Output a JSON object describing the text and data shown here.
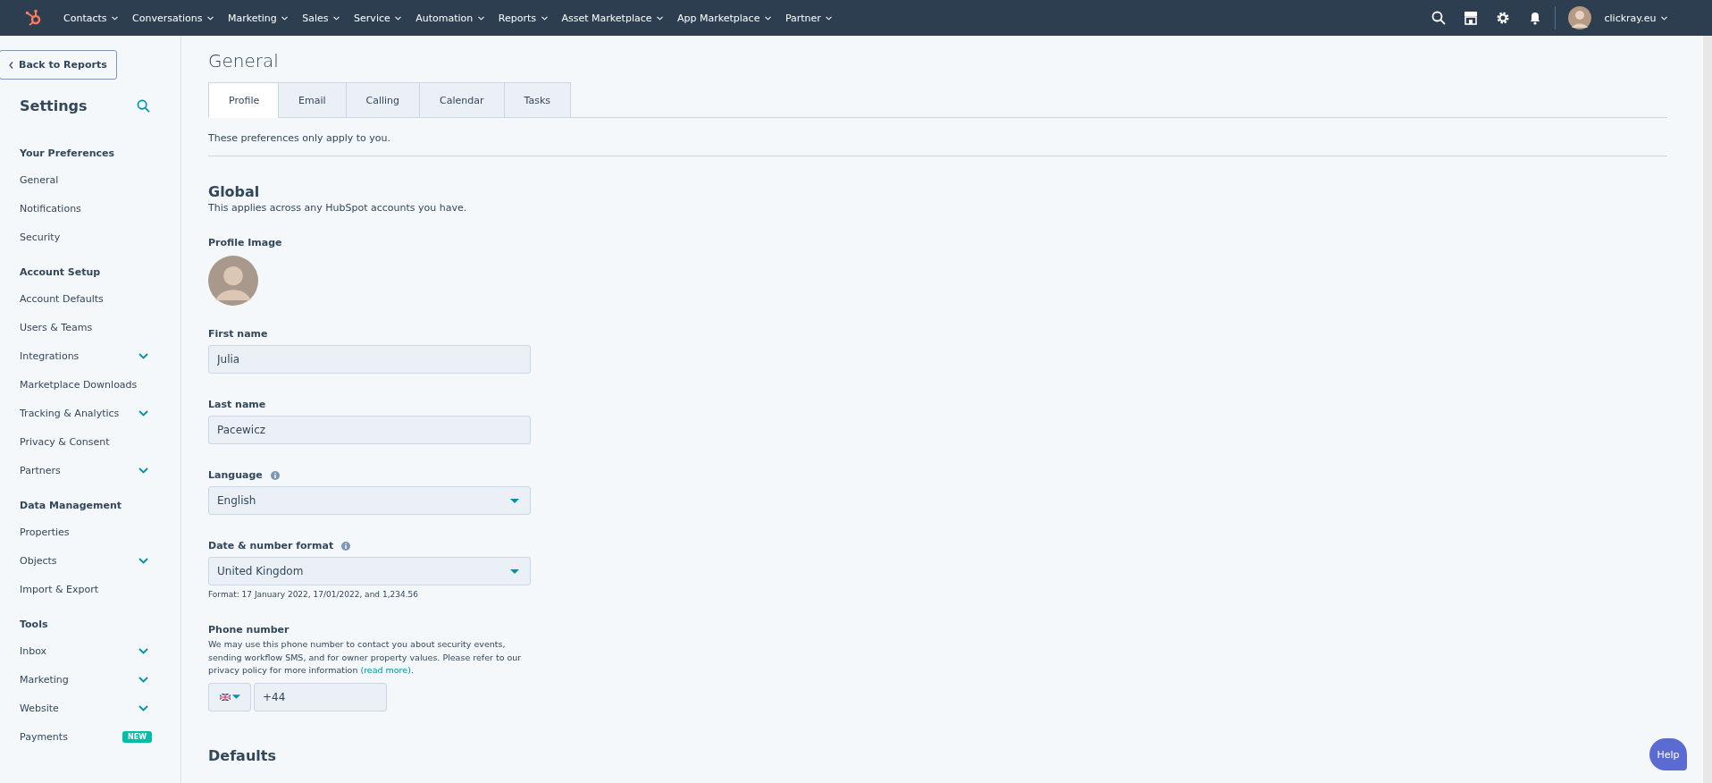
{
  "top_nav": {
    "menus": [
      "Contacts",
      "Conversations",
      "Marketing",
      "Sales",
      "Service",
      "Automation",
      "Reports",
      "Asset Marketplace",
      "App Marketplace",
      "Partner"
    ],
    "account": "clickray.eu"
  },
  "sidebar": {
    "back_button": "Back to Reports",
    "title": "Settings",
    "sections": [
      {
        "heading": "Your Preferences",
        "items": [
          {
            "label": "General",
            "expandable": false
          },
          {
            "label": "Notifications",
            "expandable": false
          },
          {
            "label": "Security",
            "expandable": false
          }
        ]
      },
      {
        "heading": "Account Setup",
        "items": [
          {
            "label": "Account Defaults",
            "expandable": false
          },
          {
            "label": "Users & Teams",
            "expandable": false
          },
          {
            "label": "Integrations",
            "expandable": true
          },
          {
            "label": "Marketplace Downloads",
            "expandable": false
          },
          {
            "label": "Tracking & Analytics",
            "expandable": true
          },
          {
            "label": "Privacy & Consent",
            "expandable": false
          },
          {
            "label": "Partners",
            "expandable": true
          }
        ]
      },
      {
        "heading": "Data Management",
        "items": [
          {
            "label": "Properties",
            "expandable": false
          },
          {
            "label": "Objects",
            "expandable": true
          },
          {
            "label": "Import & Export",
            "expandable": false
          }
        ]
      },
      {
        "heading": "Tools",
        "items": [
          {
            "label": "Inbox",
            "expandable": true
          },
          {
            "label": "Marketing",
            "expandable": true
          },
          {
            "label": "Website",
            "expandable": true
          },
          {
            "label": "Payments",
            "expandable": false,
            "badge": "NEW"
          }
        ]
      }
    ]
  },
  "main": {
    "title": "General",
    "tabs": [
      {
        "label": "Profile",
        "selected": true
      },
      {
        "label": "Email",
        "selected": false
      },
      {
        "label": "Calling",
        "selected": false
      },
      {
        "label": "Calendar",
        "selected": false
      },
      {
        "label": "Tasks",
        "selected": false
      }
    ],
    "intro": "These preferences only apply to you.",
    "section": {
      "heading": "Global",
      "description": "This applies across any HubSpot accounts you have.",
      "profile_image_label": "Profile Image",
      "fields": [
        {
          "kind": "text",
          "label": "First name",
          "value": "Julia"
        },
        {
          "kind": "text",
          "label": "Last name",
          "value": "Pacewicz"
        },
        {
          "kind": "select",
          "label": "Language",
          "info": true,
          "value": "English"
        },
        {
          "kind": "select",
          "label": "Date & number format",
          "info": true,
          "value": "United Kingdom",
          "hint": "Format: 17 January 2022, 17/01/2022, and 1,234.56"
        },
        {
          "kind": "phone",
          "label": "Phone number",
          "description": "We may use this phone number to contact you about security events, sending workflow SMS, and for owner property values. Please refer to our privacy policy for more information ",
          "link": "(read more)",
          "after_link": ".",
          "value": "+44"
        }
      ]
    },
    "next_heading": "Defaults"
  },
  "help_button": "Help"
}
